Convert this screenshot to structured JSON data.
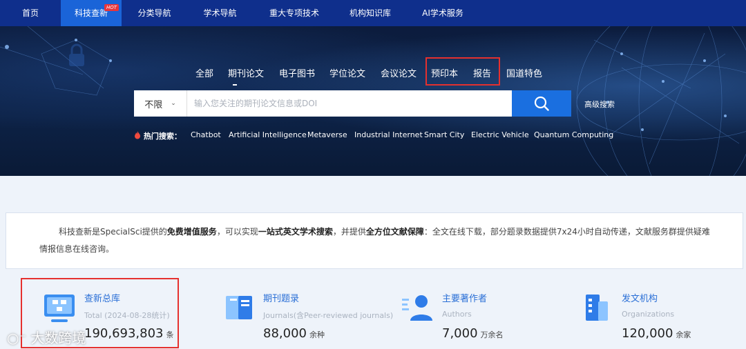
{
  "nav": {
    "items": [
      "首页",
      "科技查新",
      "分类导航",
      "学术导航",
      "重大专项技术",
      "机构知识库",
      "AI学术服务"
    ],
    "hot_badge": "HOT",
    "active_index": 1
  },
  "search_tabs": [
    "全部",
    "期刊论文",
    "电子图书",
    "学位论文",
    "会议论文",
    "预印本",
    "报告",
    "国道特色"
  ],
  "search": {
    "scope": "不限",
    "placeholder": "输入您关注的期刊论文信息或DOI",
    "advanced_label": "高级搜索"
  },
  "hot_search": {
    "label": "热门搜索：",
    "terms": [
      "Chatbot",
      "Artificial Intelligence",
      "Metaverse",
      "Industrial Internet",
      "Smart City",
      "Electric Vehicle",
      "Quantum Computing"
    ]
  },
  "description": {
    "t1": "科技查新是SpecialSci提供的",
    "b1": "免费增值服务",
    "t2": "，可以实现",
    "b2": "一站式英文学术搜索",
    "t3": "，并提供",
    "b3": "全方位文献保障",
    "t4": "：全文在线下载，部分题录数据提供7x24小时自动传递，文献服务群提供疑难情报信息在线咨询。"
  },
  "stats": [
    {
      "title": "查新总库",
      "sub": "Total (2024-08-28统计)",
      "number": "190,693,803",
      "unit": "条",
      "icon": "database-icon"
    },
    {
      "title": "期刊题录",
      "sub": "Journals(含Peer-reviewed journals)",
      "number": "88,000",
      "unit": "余种",
      "icon": "book-icon"
    },
    {
      "title": "主要著作者",
      "sub": "Authors",
      "number": "7,000",
      "unit": "万余名",
      "icon": "author-icon"
    },
    {
      "title": "发文机构",
      "sub": "Organizations",
      "number": "120,000",
      "unit": "余家",
      "icon": "building-icon"
    }
  ],
  "watermark": "大数跨境",
  "colors": {
    "nav_bg": "#0f2f8c",
    "nav_active": "#1a64d8",
    "accent": "#1a6fe0",
    "highlight_box": "#e5302e",
    "hot_badge": "#e8353b"
  }
}
